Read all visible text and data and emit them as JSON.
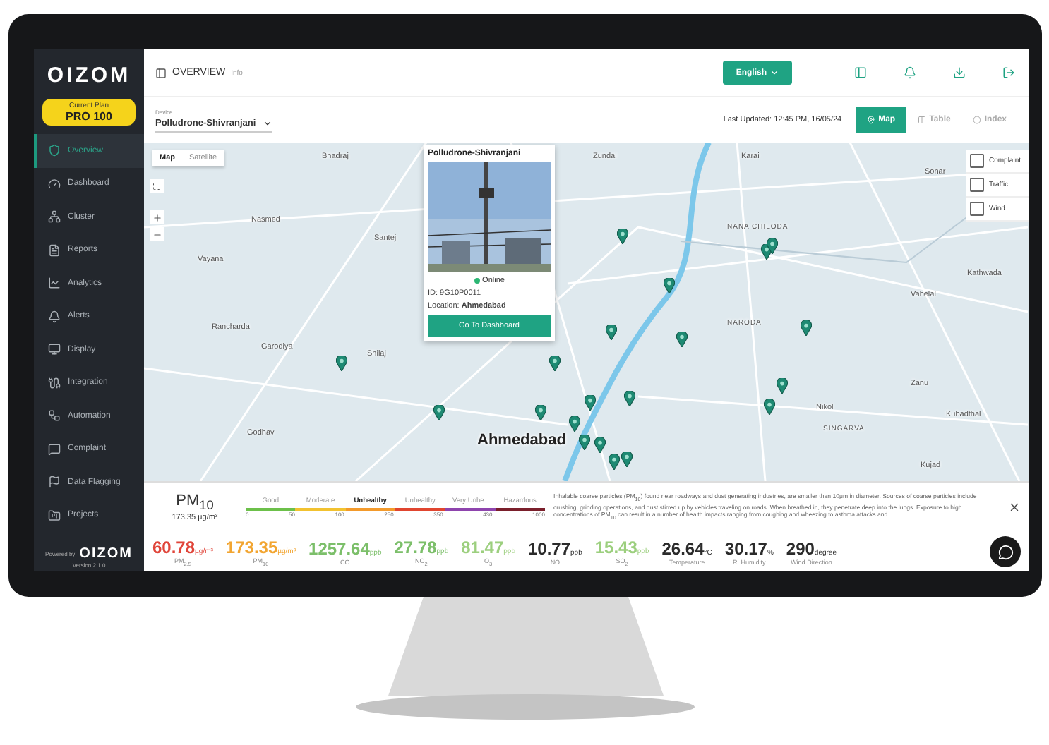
{
  "sidebar": {
    "logo": "OIZOM",
    "plan": {
      "label": "Current Plan",
      "name": "PRO 100"
    },
    "items": [
      {
        "label": "Overview",
        "selected": true
      },
      {
        "label": "Dashboard",
        "selected": false
      },
      {
        "label": "Cluster",
        "selected": false
      },
      {
        "label": "Reports",
        "selected": false
      },
      {
        "label": "Analytics",
        "selected": false
      },
      {
        "label": "Alerts",
        "selected": false
      },
      {
        "label": "Display",
        "selected": false
      },
      {
        "label": "Integration",
        "selected": false
      },
      {
        "label": "Automation",
        "selected": false
      },
      {
        "label": "Complaint",
        "selected": false
      },
      {
        "label": "Data Flagging",
        "selected": false
      },
      {
        "label": "Projects",
        "selected": false
      }
    ],
    "powered_by": "Powered by",
    "footer_logo": "OIZOM",
    "version": "Version 2.1.0"
  },
  "header": {
    "title": "OVERVIEW",
    "subtitle": "Info",
    "language": "English"
  },
  "toolbar": {
    "device_label": "Device",
    "device": "Polludrone-Shivranjani",
    "last_updated": "Last Updated: 12:45 PM, 16/05/24",
    "views": [
      {
        "label": "Map",
        "selected": true
      },
      {
        "label": "Table",
        "selected": false
      },
      {
        "label": "Index",
        "selected": false
      }
    ]
  },
  "map": {
    "types": [
      {
        "label": "Map",
        "selected": true
      },
      {
        "label": "Satellite",
        "selected": false
      }
    ],
    "places": [
      {
        "name": "Bhadraj",
        "kind": "town"
      },
      {
        "name": "Zundal",
        "kind": "town"
      },
      {
        "name": "Karai",
        "kind": "town"
      },
      {
        "name": "Sonar",
        "kind": "town"
      },
      {
        "name": "Nasmed",
        "kind": "town"
      },
      {
        "name": "Santej",
        "kind": "town"
      },
      {
        "name": "Vayana",
        "kind": "town"
      },
      {
        "name": "Rancharda",
        "kind": "town"
      },
      {
        "name": "Garodiya",
        "kind": "town"
      },
      {
        "name": "Shilaj",
        "kind": "town"
      },
      {
        "name": "Godhav",
        "kind": "town"
      },
      {
        "name": "NANA CHILODA",
        "kind": "area"
      },
      {
        "name": "NARODA",
        "kind": "area"
      },
      {
        "name": "Vahelal",
        "kind": "town"
      },
      {
        "name": "Kathwada",
        "kind": "town"
      },
      {
        "name": "Zanu",
        "kind": "town"
      },
      {
        "name": "Kubadthal",
        "kind": "town"
      },
      {
        "name": "Nikol",
        "kind": "town"
      },
      {
        "name": "SINGARVA",
        "kind": "area"
      },
      {
        "name": "Ahmedabad",
        "kind": "city"
      },
      {
        "name": "Kujad",
        "kind": "town"
      }
    ],
    "layers": [
      {
        "label": "Complaint",
        "checked": false
      },
      {
        "label": "Traffic",
        "checked": false
      },
      {
        "label": "Wind",
        "checked": false
      }
    ],
    "popup": {
      "title": "Polludrone-Shivranjani",
      "status": "Online",
      "id": "ID: 9G10P0011",
      "location_label": "Location:",
      "location": "Ahmedabad",
      "button": "Go To Dashboard"
    }
  },
  "pollutant": {
    "name": "PM$_{10}$",
    "reading": "173.35 µg/m³",
    "scale": [
      {
        "label": "Good",
        "color": "#6cc04a",
        "selected": false
      },
      {
        "label": "Moderate",
        "color": "#f2c230",
        "selected": false
      },
      {
        "label": "Unhealthy",
        "color": "#f39a2b",
        "selected": true
      },
      {
        "label": "Unhealthy",
        "color": "#e0452f",
        "selected": false
      },
      {
        "label": "Very Unhe..",
        "color": "#8e44ad",
        "selected": false
      },
      {
        "label": "Hazardous",
        "color": "#7a1f2b",
        "selected": false
      }
    ],
    "ticks": [
      "0",
      "50",
      "100",
      "250",
      "350",
      "430",
      "1000"
    ],
    "description": "Inhalable coarse particles (PM$_{10}$) found near roadways and dust generating industries, are smaller than 10μm in diameter. Sources of coarse particles include crushing, grinding operations, and dust stirred up by vehicles traveling on roads. When breathed in, they penetrate deep into the lungs. Exposure to high concentrations of PM$_{10}$ can result in a number of health impacts ranging from coughing and wheezing to asthma attacks and"
  },
  "metrics": [
    {
      "value": "60.78",
      "unit": "µg/m³",
      "label": "PM$_{2.5}$",
      "color": "#e0453a"
    },
    {
      "value": "173.35",
      "unit": "µg/m³",
      "label": "PM$_{10}$",
      "color": "#f2a531"
    },
    {
      "value": "1257.64",
      "unit": "ppb",
      "label": "CO",
      "color": "#7cbf6a"
    },
    {
      "value": "27.78",
      "unit": "ppb",
      "label": "NO$_{2}$",
      "color": "#7cbf6a"
    },
    {
      "value": "81.47",
      "unit": "ppb",
      "label": "O$_{3}$",
      "color": "#9ccf7e"
    },
    {
      "value": "10.77",
      "unit": "ppb",
      "label": "NO",
      "color": "#2b2b2b"
    },
    {
      "value": "15.43",
      "unit": "ppb",
      "label": "SO$_{2}$",
      "color": "#9ccf7e"
    },
    {
      "value": "26.64",
      "unit": "°C",
      "label": "Temperature",
      "color": "#2b2b2b"
    },
    {
      "value": "30.17",
      "unit": "%",
      "label": "R. Humidity",
      "color": "#2b2b2b"
    },
    {
      "value": "290",
      "unit": "degree",
      "label": "Wind Direction",
      "color": "#2b2b2b"
    }
  ]
}
